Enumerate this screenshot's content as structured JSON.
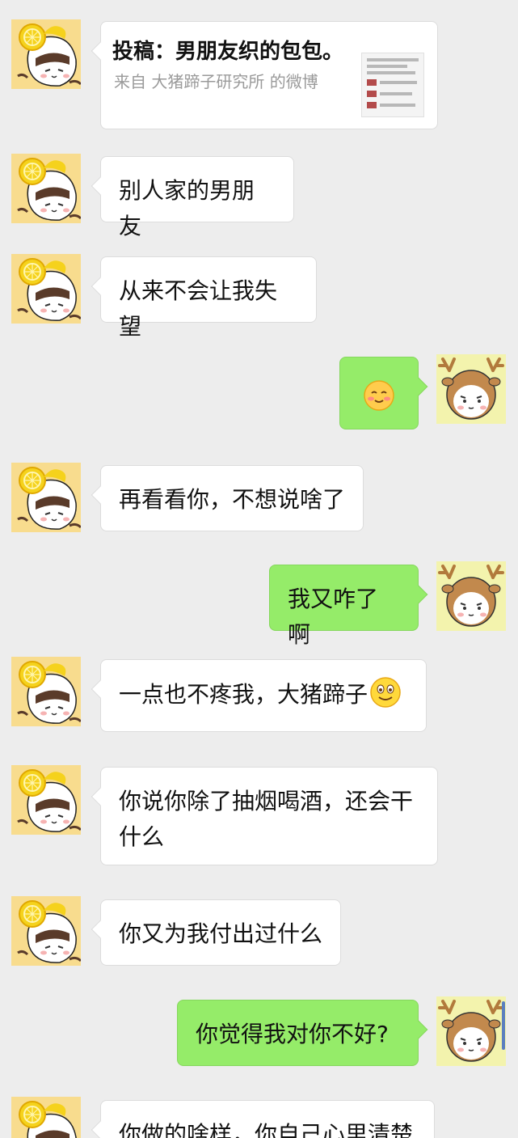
{
  "chat": {
    "share_card": {
      "title": "投稿：男朋友织的包包。",
      "source": "来自 大猪蹄子研究所 的微博"
    },
    "messages": [
      {
        "from": "her",
        "text": "别人家的男朋友"
      },
      {
        "from": "her",
        "text": "从来不会让我失望"
      },
      {
        "from": "me",
        "emoji": "smile-blush"
      },
      {
        "from": "her",
        "text": "再看看你，不想说啥了"
      },
      {
        "from": "me",
        "text": "我又咋了啊"
      },
      {
        "from": "her",
        "text": "一点也不疼我，大猪蹄子",
        "emoji": "grin-smiley"
      },
      {
        "from": "her",
        "text": "你说你除了抽烟喝酒，还会干什么"
      },
      {
        "from": "her",
        "text": "你又为我付出过什么"
      },
      {
        "from": "me",
        "text": "你觉得我对你不好?"
      },
      {
        "from": "her",
        "text": "你做的啥样，你自己心里清楚"
      }
    ]
  },
  "colors": {
    "background": "#ededed",
    "sent_bubble": "#95ec69",
    "received_bubble": "#ffffff",
    "her_avatar_bg": "#f8dc8e",
    "my_avatar_bg": "#f3f3ad"
  }
}
